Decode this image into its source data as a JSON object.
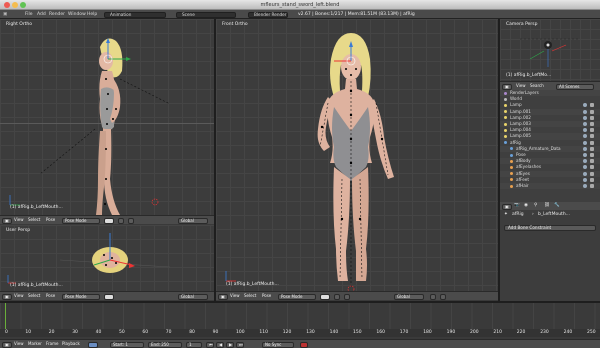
{
  "window": {
    "title": "mfleurs_stand_sword_left.blend"
  },
  "infobar": {
    "menus": [
      "File",
      "Add",
      "Render",
      "Window",
      "Help"
    ],
    "layout": "Animation",
    "scene": "Scene",
    "engine": "Blender Render",
    "stats": "v2.67 | Bones:1/217 | Mem:81.51M (83.13M) | afRig"
  },
  "viewports": {
    "right_ortho": {
      "label": "Right Ortho",
      "object": "(1) afRig.b_LeftMouth..."
    },
    "front_ortho": {
      "label": "Front Ortho",
      "object": "(1) afRig.b_LeftMouth..."
    },
    "user_persp": {
      "label": "User Persp",
      "object": "(1) afRig.b_LeftMouth..."
    },
    "camera_persp": {
      "label": "Camera Persp",
      "object": "(1) afRig.b_LeftMo..."
    }
  },
  "viewport_header": {
    "menus": [
      "View",
      "Select",
      "Pose"
    ],
    "mode": "Pose Mode",
    "orientation": "Global"
  },
  "outliner": {
    "menus": [
      "View",
      "Search"
    ],
    "filter": "All Scenes",
    "rows": [
      "Lamp",
      "Lamp.001",
      "Lamp.002",
      "Lamp.003",
      "Lamp.004",
      "Lamp.005",
      "afRig",
      "afRig_Armature_Data",
      "Pose",
      "afBody",
      "afEyelashes",
      "afEyes",
      "afFeet",
      "afHair"
    ],
    "labels": [
      "RenderLayers",
      "World"
    ]
  },
  "properties": {
    "object": "afRig",
    "bone": "b_LeftMouth...",
    "add_constraint": "Add Bone Constraint"
  },
  "timeline": {
    "menus": [
      "View",
      "Marker",
      "Frame",
      "Playback"
    ],
    "start": "Start: 1",
    "end": "End: 250",
    "current": "1",
    "sync": "No Sync",
    "ticks": [
      "0",
      "10",
      "20",
      "30",
      "40",
      "50",
      "60",
      "70",
      "80",
      "90",
      "100",
      "110",
      "120",
      "130",
      "140",
      "150",
      "160",
      "170",
      "180",
      "190",
      "200",
      "210",
      "220",
      "230",
      "240",
      "250"
    ]
  }
}
